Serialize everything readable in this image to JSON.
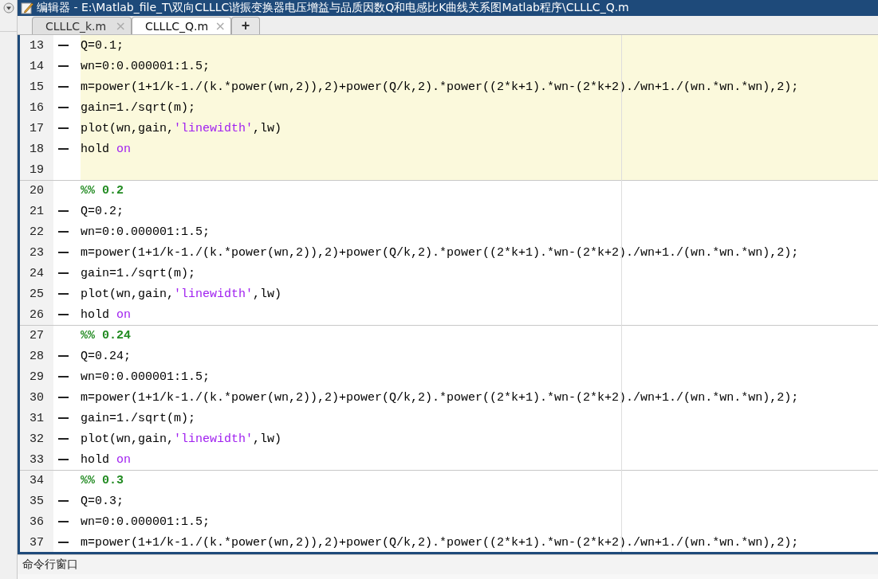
{
  "window": {
    "title": "编辑器 - E:\\Matlab_file_T\\双向CLLLC谐振变换器电压增益与品质因数Q和电感比K曲线关系图Matlab程序\\CLLLC_Q.m"
  },
  "tabs": [
    {
      "label": "CLLLC_k.m",
      "selected": false,
      "close": "×"
    },
    {
      "label": "CLLLC_Q.m",
      "selected": true,
      "close": "×"
    }
  ],
  "new_tab": "+",
  "cells": [
    {
      "highlighted": true,
      "lines": [
        {
          "number": "13",
          "executable": true,
          "segments": [
            {
              "kind": "code",
              "text": "Q=0.1;"
            }
          ]
        },
        {
          "number": "14",
          "executable": true,
          "segments": [
            {
              "kind": "code",
              "text": "wn=0:0.000001:1.5;"
            }
          ]
        },
        {
          "number": "15",
          "executable": true,
          "segments": [
            {
              "kind": "code",
              "text": "m=power(1+1/k-1./(k.*power(wn,2)),2)+power(Q/k,2).*power((2*k+1).*wn-(2*k+2)./wn+1./(wn.*wn.*wn),2);"
            }
          ]
        },
        {
          "number": "16",
          "executable": true,
          "segments": [
            {
              "kind": "code",
              "text": "gain=1./sqrt(m);"
            }
          ]
        },
        {
          "number": "17",
          "executable": true,
          "segments": [
            {
              "kind": "code",
              "text": "plot(wn,gain,"
            },
            {
              "kind": "string",
              "text": "'linewidth'"
            },
            {
              "kind": "code",
              "text": ",lw)"
            }
          ]
        },
        {
          "number": "18",
          "executable": true,
          "segments": [
            {
              "kind": "code",
              "text": "hold "
            },
            {
              "kind": "keyword",
              "text": "on"
            }
          ]
        },
        {
          "number": "19",
          "executable": false
        }
      ]
    },
    {
      "highlighted": false,
      "lines": [
        {
          "number": "20",
          "executable": false,
          "segments": [
            {
              "kind": "comment",
              "text": "%% 0.2"
            }
          ]
        },
        {
          "number": "21",
          "executable": true,
          "segments": [
            {
              "kind": "code",
              "text": "Q=0.2;"
            }
          ]
        },
        {
          "number": "22",
          "executable": true,
          "segments": [
            {
              "kind": "code",
              "text": "wn=0:0.000001:1.5;"
            }
          ]
        },
        {
          "number": "23",
          "executable": true,
          "segments": [
            {
              "kind": "code",
              "text": "m=power(1+1/k-1./(k.*power(wn,2)),2)+power(Q/k,2).*power((2*k+1).*wn-(2*k+2)./wn+1./(wn.*wn.*wn),2);"
            }
          ]
        },
        {
          "number": "24",
          "executable": true,
          "segments": [
            {
              "kind": "code",
              "text": "gain=1./sqrt(m);"
            }
          ]
        },
        {
          "number": "25",
          "executable": true,
          "segments": [
            {
              "kind": "code",
              "text": "plot(wn,gain,"
            },
            {
              "kind": "string",
              "text": "'linewidth'"
            },
            {
              "kind": "code",
              "text": ",lw)"
            }
          ]
        },
        {
          "number": "26",
          "executable": true,
          "segments": [
            {
              "kind": "code",
              "text": "hold "
            },
            {
              "kind": "keyword",
              "text": "on"
            }
          ]
        }
      ]
    },
    {
      "highlighted": false,
      "lines": [
        {
          "number": "27",
          "executable": false,
          "segments": [
            {
              "kind": "comment",
              "text": "%% 0.24"
            }
          ]
        },
        {
          "number": "28",
          "executable": true,
          "segments": [
            {
              "kind": "code",
              "text": "Q=0.24;"
            }
          ]
        },
        {
          "number": "29",
          "executable": true,
          "segments": [
            {
              "kind": "code",
              "text": "wn=0:0.000001:1.5;"
            }
          ]
        },
        {
          "number": "30",
          "executable": true,
          "segments": [
            {
              "kind": "code",
              "text": "m=power(1+1/k-1./(k.*power(wn,2)),2)+power(Q/k,2).*power((2*k+1).*wn-(2*k+2)./wn+1./(wn.*wn.*wn),2);"
            }
          ]
        },
        {
          "number": "31",
          "executable": true,
          "segments": [
            {
              "kind": "code",
              "text": "gain=1./sqrt(m);"
            }
          ]
        },
        {
          "number": "32",
          "executable": true,
          "segments": [
            {
              "kind": "code",
              "text": "plot(wn,gain,"
            },
            {
              "kind": "string",
              "text": "'linewidth'"
            },
            {
              "kind": "code",
              "text": ",lw)"
            }
          ]
        },
        {
          "number": "33",
          "executable": true,
          "segments": [
            {
              "kind": "code",
              "text": "hold "
            },
            {
              "kind": "keyword",
              "text": "on"
            }
          ]
        }
      ]
    },
    {
      "highlighted": false,
      "lines": [
        {
          "number": "34",
          "executable": false,
          "segments": [
            {
              "kind": "comment",
              "text": "%% 0.3"
            }
          ]
        },
        {
          "number": "35",
          "executable": true,
          "segments": [
            {
              "kind": "code",
              "text": "Q=0.3;"
            }
          ]
        },
        {
          "number": "36",
          "executable": true,
          "segments": [
            {
              "kind": "code",
              "text": "wn=0:0.000001:1.5;"
            }
          ]
        },
        {
          "number": "37",
          "executable": true,
          "segments": [
            {
              "kind": "code",
              "text": "m=power(1+1/k-1./(k.*power(wn,2)),2)+power(Q/k,2).*power((2*k+1).*wn-(2*k+2)./wn+1./(wn.*wn.*wn),2);"
            }
          ]
        }
      ]
    }
  ],
  "command_window": {
    "title": "命令行窗口"
  }
}
